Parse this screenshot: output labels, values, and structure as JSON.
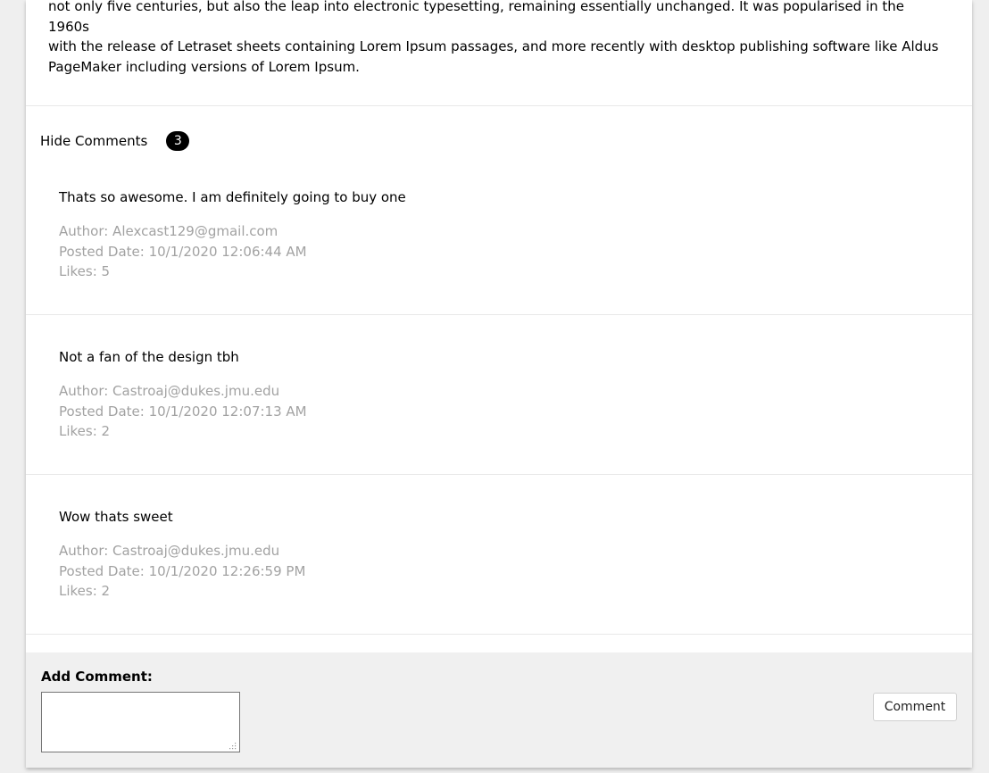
{
  "article": {
    "text_lines": [
      "not only five centuries, but also the leap into electronic typesetting, remaining essentially unchanged. It was popularised in the 1960s",
      "with the release of Letraset sheets containing Lorem Ipsum passages, and more recently with desktop publishing software like Aldus",
      "PageMaker including versions of Lorem Ipsum."
    ]
  },
  "comments_toggle": {
    "label": "Hide Comments",
    "count": "3"
  },
  "comments": [
    {
      "text": "Thats so awesome. I am definitely going to buy one",
      "author": "Author: Alexcast129@gmail.com",
      "posted": "Posted Date: 10/1/2020 12:06:44 AM",
      "likes": "Likes: 5"
    },
    {
      "text": "Not a fan of the design tbh",
      "author": "Author: Castroaj@dukes.jmu.edu",
      "posted": "Posted Date: 10/1/2020 12:07:13 AM",
      "likes": "Likes: 2"
    },
    {
      "text": "Wow thats sweet",
      "author": "Author: Castroaj@dukes.jmu.edu",
      "posted": "Posted Date: 10/1/2020 12:26:59 PM",
      "likes": "Likes: 2"
    }
  ],
  "add_comment": {
    "label": "Add Comment:",
    "input_value": "",
    "button_label": "Comment"
  },
  "colors": {
    "page_background": "#efefef",
    "card_background": "#ffffff",
    "meta_text": "#a2a2a2",
    "badge_background": "#000000",
    "add_section_background": "#f0f0f0"
  }
}
